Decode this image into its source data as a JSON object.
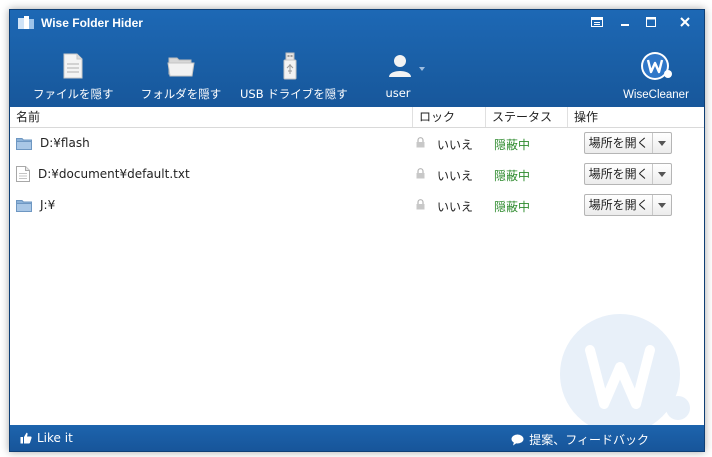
{
  "window": {
    "title": "Wise Folder Hider"
  },
  "toolbar": {
    "hide_file": "ファイルを隠す",
    "hide_folder": "フォルダを隠す",
    "hide_usb": "USB ドライブを隠す",
    "user": "user",
    "brand": "WiseCleaner"
  },
  "columns": {
    "name": "名前",
    "lock": "ロック",
    "status": "ステータス",
    "action": "操作"
  },
  "rows": [
    {
      "icon": "folder-icon",
      "name": "D:¥flash",
      "lock": "いいえ",
      "status": "隠蔽中",
      "action": "場所を開く"
    },
    {
      "icon": "file-icon",
      "name": "D:¥document¥default.txt",
      "lock": "いいえ",
      "status": "隠蔽中",
      "action": "場所を開く"
    },
    {
      "icon": "folder-icon",
      "name": "J:¥",
      "lock": "いいえ",
      "status": "隠蔽中",
      "action": "場所を開く"
    }
  ],
  "footer": {
    "like": "Like it",
    "feedback": "提案、フィードバック"
  },
  "colors": {
    "accent": "#1a5fa8",
    "status_green": "#2e8b2e"
  }
}
